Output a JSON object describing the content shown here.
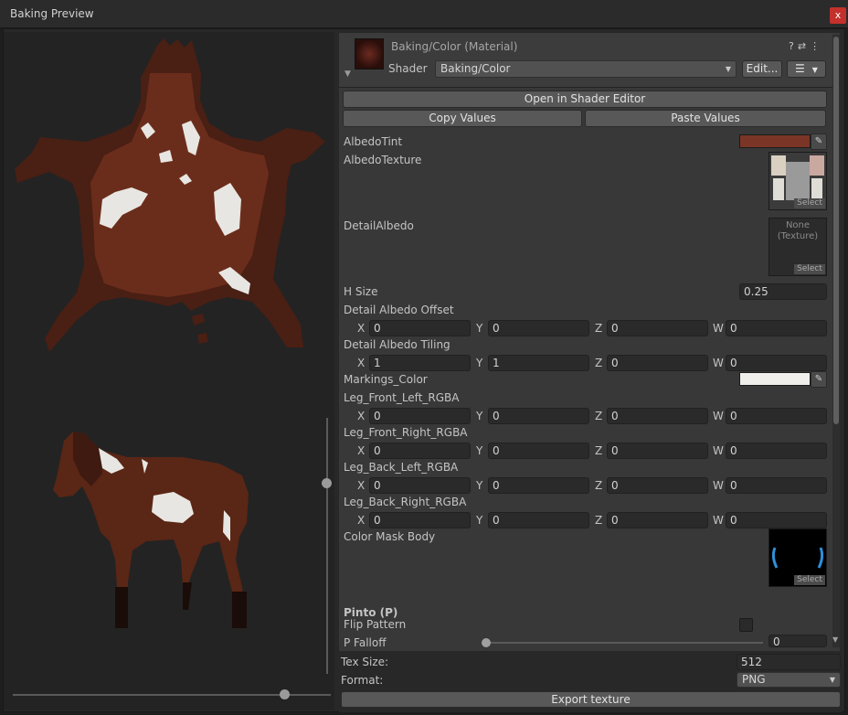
{
  "window": {
    "title": "Baking Preview",
    "close_label": "x"
  },
  "header": {
    "material_title": "Baking/Color (Material)",
    "shader_label": "Shader",
    "shader_value": "Baking/Color",
    "edit_label": "Edit...",
    "icons": [
      "help-icon",
      "preset-icon",
      "more-icon"
    ]
  },
  "buttons": {
    "open_shader_editor": "Open in Shader Editor",
    "copy_values": "Copy Values",
    "paste_values": "Paste Values",
    "export_texture": "Export texture"
  },
  "properties": {
    "albedo_tint": {
      "label": "AlbedoTint",
      "color": "#7a3526"
    },
    "albedo_texture": {
      "label": "AlbedoTexture",
      "select": "Select"
    },
    "detail_albedo": {
      "label": "DetailAlbedo",
      "none_line1": "None",
      "none_line2": "(Texture)",
      "select": "Select"
    },
    "h_size": {
      "label": "H Size",
      "value": "0.25"
    },
    "detail_albedo_offset": {
      "label": "Detail Albedo Offset",
      "x": "0",
      "y": "0",
      "z": "0",
      "w": "0"
    },
    "detail_albedo_tiling": {
      "label": "Detail Albedo Tiling",
      "x": "1",
      "y": "1",
      "z": "0",
      "w": "0"
    },
    "markings_color": {
      "label": "Markings_Color",
      "color": "#f0eeea"
    },
    "leg_front_left": {
      "label": "Leg_Front_Left_RGBA",
      "x": "0",
      "y": "0",
      "z": "0",
      "w": "0"
    },
    "leg_front_right": {
      "label": "Leg_Front_Right_RGBA",
      "x": "0",
      "y": "0",
      "z": "0",
      "w": "0"
    },
    "leg_back_left": {
      "label": "Leg_Back_Left_RGBA",
      "x": "0",
      "y": "0",
      "z": "0",
      "w": "0"
    },
    "leg_back_right": {
      "label": "Leg_Back_Right_RGBA",
      "x": "0",
      "y": "0",
      "z": "0",
      "w": "0"
    },
    "color_mask_body": {
      "label": "Color Mask Body",
      "select": "Select"
    },
    "pinto_header": "Pinto (P)",
    "flip_pattern": {
      "label": "Flip Pattern",
      "checked": false
    },
    "p_falloff": {
      "label": "P Falloff",
      "value": "0"
    }
  },
  "axes": {
    "x": "X",
    "y": "Y",
    "z": "Z",
    "w": "W"
  },
  "export": {
    "tex_size_label": "Tex Size:",
    "tex_size_value": "512",
    "format_label": "Format:",
    "format_value": "PNG"
  },
  "colors": {
    "hide_base": "#3a1a12",
    "hide_mid": "#5e2818",
    "markings": "#e8e6e2",
    "accent_close": "#c4302b"
  }
}
